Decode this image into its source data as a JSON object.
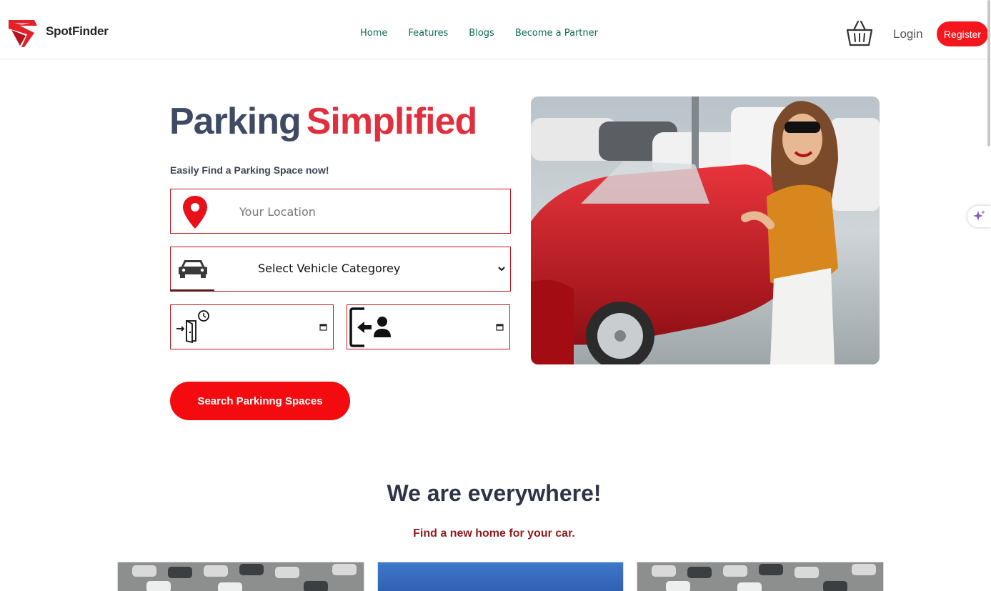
{
  "header": {
    "brand": "SpotFinder",
    "nav": [
      "Home",
      "Features",
      "Blogs",
      "Become a Partner"
    ],
    "login_label": "Login",
    "register_label": "Register"
  },
  "hero": {
    "title_part1": "Parking",
    "title_part2": "Simplified",
    "subtitle": "Easily Find a Parking Space now!",
    "location_placeholder": "Your Location",
    "vehicle_select_value": "Select Vehicle Categorey",
    "search_button": "Search Parkinng Spaces"
  },
  "section": {
    "title": "We are everywhere!",
    "subtitle": "Find a new home for your car."
  },
  "colors": {
    "accent_red": "#f40b0f",
    "title_dark": "#3f4a64",
    "title_red": "#e0303e",
    "nav_green": "#0d6b5a",
    "border_red": "#c0161b"
  },
  "icons": [
    "spotfinder-logo-icon",
    "basket-icon",
    "location-pin-icon",
    "car-icon",
    "chevron-down-icon",
    "entry-door-clock-icon",
    "exit-person-icon",
    "calendar-icon",
    "sparkle-icon"
  ]
}
